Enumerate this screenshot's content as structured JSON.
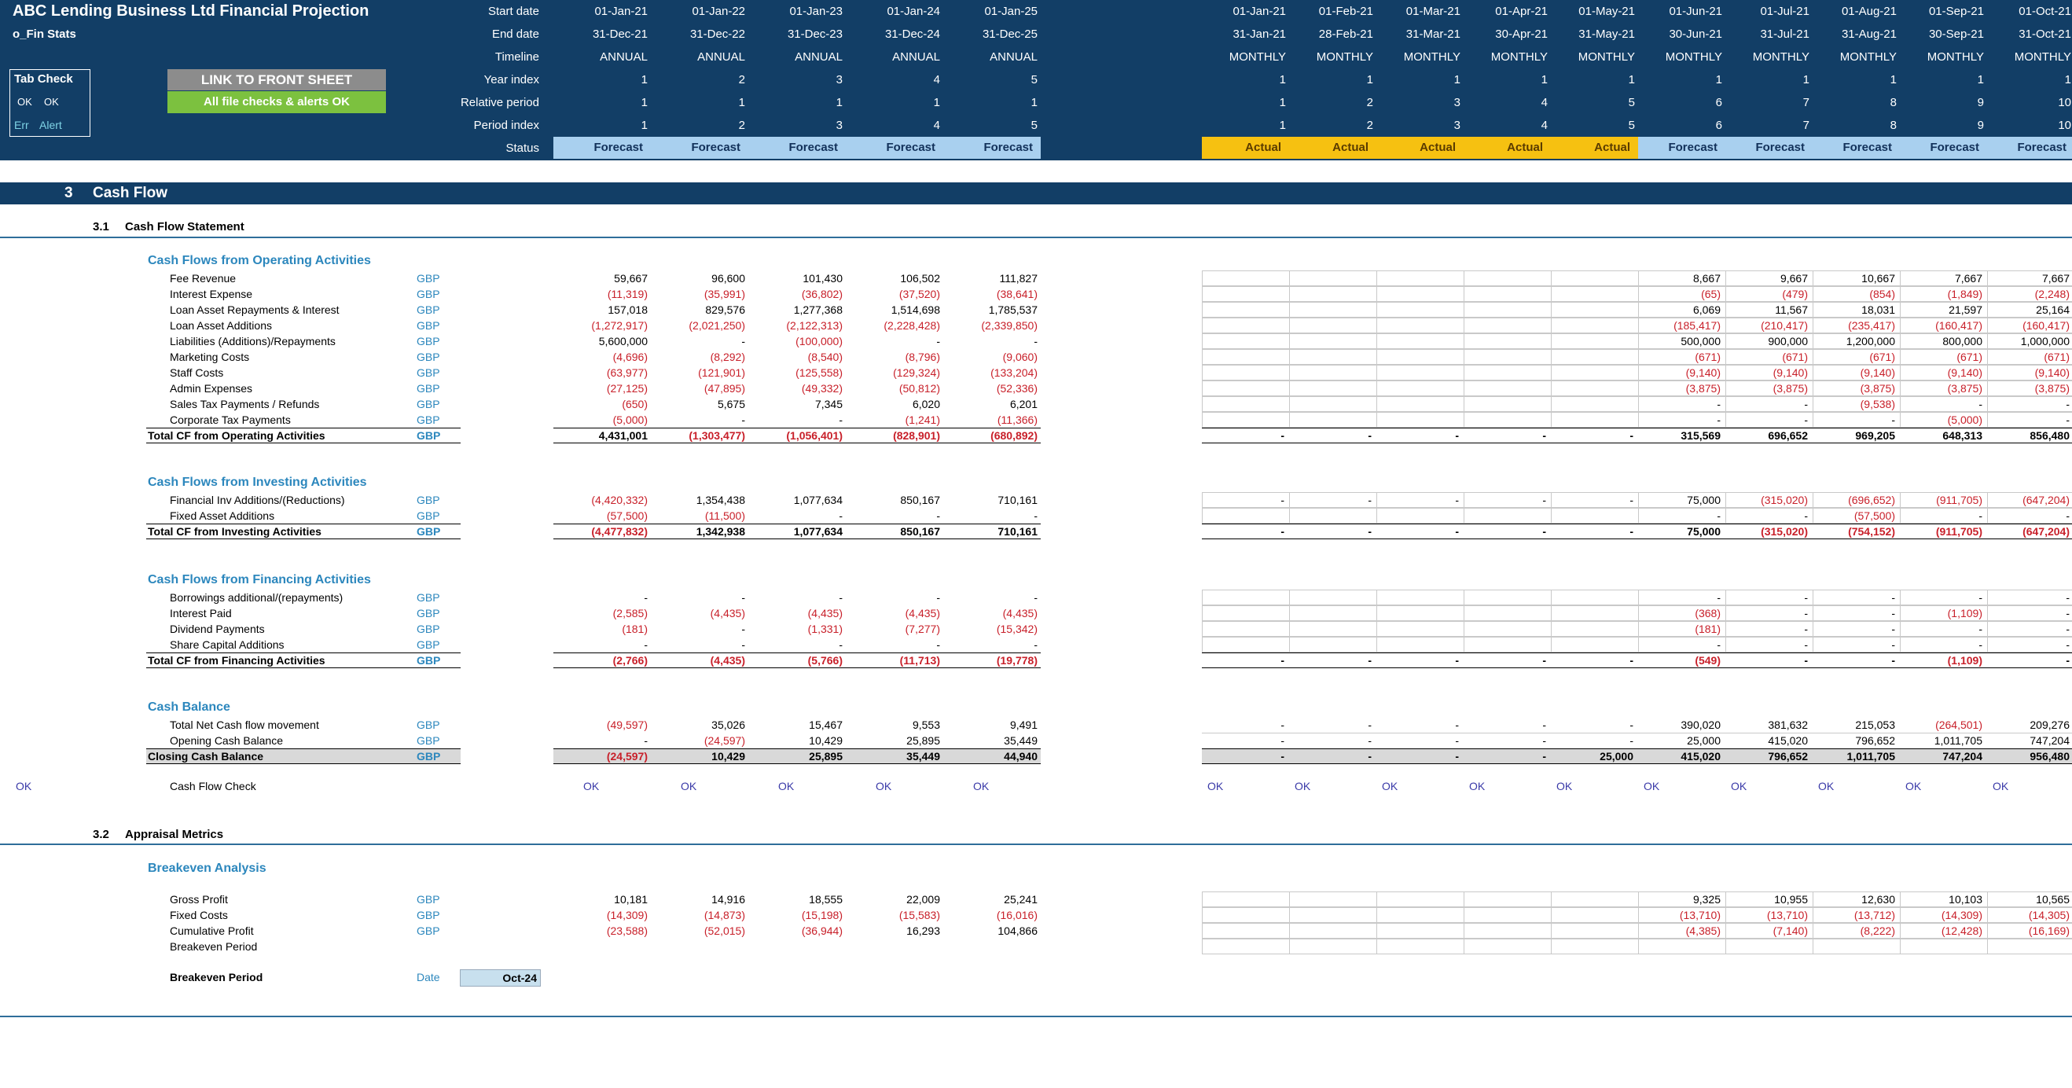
{
  "header": {
    "company": "ABC Lending Business Ltd Financial Projection",
    "sheet": "o_Fin Stats",
    "tab_check": {
      "title": "Tab Check",
      "ok1": "OK",
      "ok2": "OK",
      "err": "Err",
      "alert": "Alert"
    },
    "link_button": "LINK TO FRONT SHEET",
    "checks_status": "All file checks & alerts OK",
    "row_labels": [
      "Start date",
      "End date",
      "Timeline",
      "Year index",
      "Relative period",
      "Period index",
      "Status"
    ],
    "annual": [
      {
        "start": "01-Jan-21",
        "end": "31-Dec-21",
        "timeline": "ANNUAL",
        "year": "1",
        "rel": "1",
        "idx": "1",
        "status": "Forecast"
      },
      {
        "start": "01-Jan-22",
        "end": "31-Dec-22",
        "timeline": "ANNUAL",
        "year": "2",
        "rel": "1",
        "idx": "2",
        "status": "Forecast"
      },
      {
        "start": "01-Jan-23",
        "end": "31-Dec-23",
        "timeline": "ANNUAL",
        "year": "3",
        "rel": "1",
        "idx": "3",
        "status": "Forecast"
      },
      {
        "start": "01-Jan-24",
        "end": "31-Dec-24",
        "timeline": "ANNUAL",
        "year": "4",
        "rel": "1",
        "idx": "4",
        "status": "Forecast"
      },
      {
        "start": "01-Jan-25",
        "end": "31-Dec-25",
        "timeline": "ANNUAL",
        "year": "5",
        "rel": "1",
        "idx": "5",
        "status": "Forecast"
      }
    ],
    "monthly": [
      {
        "start": "01-Jan-21",
        "end": "31-Jan-21",
        "timeline": "MONTHLY",
        "year": "1",
        "rel": "1",
        "idx": "1",
        "status": "Actual"
      },
      {
        "start": "01-Feb-21",
        "end": "28-Feb-21",
        "timeline": "MONTHLY",
        "year": "1",
        "rel": "2",
        "idx": "2",
        "status": "Actual"
      },
      {
        "start": "01-Mar-21",
        "end": "31-Mar-21",
        "timeline": "MONTHLY",
        "year": "1",
        "rel": "3",
        "idx": "3",
        "status": "Actual"
      },
      {
        "start": "01-Apr-21",
        "end": "30-Apr-21",
        "timeline": "MONTHLY",
        "year": "1",
        "rel": "4",
        "idx": "4",
        "status": "Actual"
      },
      {
        "start": "01-May-21",
        "end": "31-May-21",
        "timeline": "MONTHLY",
        "year": "1",
        "rel": "5",
        "idx": "5",
        "status": "Actual"
      },
      {
        "start": "01-Jun-21",
        "end": "30-Jun-21",
        "timeline": "MONTHLY",
        "year": "1",
        "rel": "6",
        "idx": "6",
        "status": "Forecast"
      },
      {
        "start": "01-Jul-21",
        "end": "31-Jul-21",
        "timeline": "MONTHLY",
        "year": "1",
        "rel": "7",
        "idx": "7",
        "status": "Forecast"
      },
      {
        "start": "01-Aug-21",
        "end": "31-Aug-21",
        "timeline": "MONTHLY",
        "year": "1",
        "rel": "8",
        "idx": "8",
        "status": "Forecast"
      },
      {
        "start": "01-Sep-21",
        "end": "30-Sep-21",
        "timeline": "MONTHLY",
        "year": "1",
        "rel": "9",
        "idx": "9",
        "status": "Forecast"
      },
      {
        "start": "01-Oct-21",
        "end": "31-Oct-21",
        "timeline": "MONTHLY",
        "year": "1",
        "rel": "10",
        "idx": "10",
        "status": "Forecast"
      }
    ]
  },
  "section": {
    "num": "3",
    "title": "Cash Flow"
  },
  "sub31": {
    "num": "3.1",
    "title": "Cash Flow Statement"
  },
  "sub32": {
    "num": "3.2",
    "title": "Appraisal Metrics"
  },
  "blocks": {
    "operating": "Cash Flows from Operating Activities",
    "investing": "Cash Flows from Investing Activities",
    "financing": "Cash Flows from Financing Activities",
    "balance": "Cash Balance",
    "breakeven": "Breakeven Analysis"
  },
  "rows": {
    "fee": {
      "label": "Fee Revenue",
      "unit": "GBP",
      "annual": [
        "59,667",
        "96,600",
        "101,430",
        "106,502",
        "111,827"
      ],
      "monthly": [
        "",
        "",
        "",
        "",
        "",
        "8,667",
        "9,667",
        "10,667",
        "7,667",
        "7,667"
      ]
    },
    "interest": {
      "label": "Interest Expense",
      "unit": "GBP",
      "annual": [
        "(11,319)",
        "(35,991)",
        "(36,802)",
        "(37,520)",
        "(38,641)"
      ],
      "monthly": [
        "",
        "",
        "",
        "",
        "",
        "(65)",
        "(479)",
        "(854)",
        "(1,849)",
        "(2,248)"
      ]
    },
    "loanrep": {
      "label": "Loan Asset Repayments & Interest",
      "unit": "GBP",
      "annual": [
        "157,018",
        "829,576",
        "1,277,368",
        "1,514,698",
        "1,785,537"
      ],
      "monthly": [
        "",
        "",
        "",
        "",
        "",
        "6,069",
        "11,567",
        "18,031",
        "21,597",
        "25,164"
      ]
    },
    "loanadd": {
      "label": "Loan Asset Additions",
      "unit": "GBP",
      "annual": [
        "(1,272,917)",
        "(2,021,250)",
        "(2,122,313)",
        "(2,228,428)",
        "(2,339,850)"
      ],
      "monthly": [
        "",
        "",
        "",
        "",
        "",
        "(185,417)",
        "(210,417)",
        "(235,417)",
        "(160,417)",
        "(160,417)"
      ]
    },
    "liab": {
      "label": "Liabilities (Additions)/Repayments",
      "unit": "GBP",
      "annual": [
        "5,600,000",
        "-",
        "(100,000)",
        "-",
        "-"
      ],
      "monthly": [
        "",
        "",
        "",
        "",
        "",
        "500,000",
        "900,000",
        "1,200,000",
        "800,000",
        "1,000,000"
      ]
    },
    "mkt": {
      "label": "Marketing Costs",
      "unit": "GBP",
      "annual": [
        "(4,696)",
        "(8,292)",
        "(8,540)",
        "(8,796)",
        "(9,060)"
      ],
      "monthly": [
        "",
        "",
        "",
        "",
        "",
        "(671)",
        "(671)",
        "(671)",
        "(671)",
        "(671)"
      ]
    },
    "staff": {
      "label": "Staff Costs",
      "unit": "GBP",
      "annual": [
        "(63,977)",
        "(121,901)",
        "(125,558)",
        "(129,324)",
        "(133,204)"
      ],
      "monthly": [
        "",
        "",
        "",
        "",
        "",
        "(9,140)",
        "(9,140)",
        "(9,140)",
        "(9,140)",
        "(9,140)"
      ]
    },
    "admin": {
      "label": "Admin Expenses",
      "unit": "GBP",
      "annual": [
        "(27,125)",
        "(47,895)",
        "(49,332)",
        "(50,812)",
        "(52,336)"
      ],
      "monthly": [
        "",
        "",
        "",
        "",
        "",
        "(3,875)",
        "(3,875)",
        "(3,875)",
        "(3,875)",
        "(3,875)"
      ]
    },
    "salestax": {
      "label": "Sales Tax Payments / Refunds",
      "unit": "GBP",
      "annual": [
        "(650)",
        "5,675",
        "7,345",
        "6,020",
        "6,201"
      ],
      "monthly": [
        "",
        "",
        "",
        "",
        "",
        "-",
        "-",
        "(9,538)",
        "-",
        "-"
      ]
    },
    "corptax": {
      "label": "Corporate Tax Payments",
      "unit": "GBP",
      "annual": [
        "(5,000)",
        "-",
        "-",
        "(1,241)",
        "(11,366)"
      ],
      "monthly": [
        "",
        "",
        "",
        "",
        "",
        "-",
        "-",
        "-",
        "(5,000)",
        "-"
      ]
    },
    "totop": {
      "label": "Total CF from Operating Activities",
      "unit": "GBP",
      "annual": [
        "4,431,001",
        "(1,303,477)",
        "(1,056,401)",
        "(828,901)",
        "(680,892)"
      ],
      "monthly": [
        "-",
        "-",
        "-",
        "-",
        "-",
        "315,569",
        "696,652",
        "969,205",
        "648,313",
        "856,480"
      ]
    },
    "finv": {
      "label": "Financial Inv Additions/(Reductions)",
      "unit": "GBP",
      "annual": [
        "(4,420,332)",
        "1,354,438",
        "1,077,634",
        "850,167",
        "710,161"
      ],
      "monthly": [
        "-",
        "-",
        "-",
        "-",
        "-",
        "75,000",
        "(315,020)",
        "(696,652)",
        "(911,705)",
        "(647,204)"
      ]
    },
    "fixed": {
      "label": "Fixed Asset Additions",
      "unit": "GBP",
      "annual": [
        "(57,500)",
        "(11,500)",
        "-",
        "-",
        "-"
      ],
      "monthly": [
        "",
        "",
        "",
        "",
        "",
        "-",
        "-",
        "(57,500)",
        "-",
        "-"
      ]
    },
    "totinv": {
      "label": "Total CF from Investing Activities",
      "unit": "GBP",
      "annual": [
        "(4,477,832)",
        "1,342,938",
        "1,077,634",
        "850,167",
        "710,161"
      ],
      "monthly": [
        "-",
        "-",
        "-",
        "-",
        "-",
        "75,000",
        "(315,020)",
        "(754,152)",
        "(911,705)",
        "(647,204)"
      ]
    },
    "borrow": {
      "label": "Borrowings additional/(repayments)",
      "unit": "GBP",
      "annual": [
        "-",
        "-",
        "-",
        "-",
        "-"
      ],
      "monthly": [
        "",
        "",
        "",
        "",
        "",
        "-",
        "-",
        "-",
        "-",
        "-"
      ]
    },
    "intpaid": {
      "label": "Interest Paid",
      "unit": "GBP",
      "annual": [
        "(2,585)",
        "(4,435)",
        "(4,435)",
        "(4,435)",
        "(4,435)"
      ],
      "monthly": [
        "",
        "",
        "",
        "",
        "",
        "(368)",
        "-",
        "-",
        "(1,109)",
        "-"
      ]
    },
    "div": {
      "label": "Dividend Payments",
      "unit": "GBP",
      "annual": [
        "(181)",
        "-",
        "(1,331)",
        "(7,277)",
        "(15,342)"
      ],
      "monthly": [
        "",
        "",
        "",
        "",
        "",
        "(181)",
        "-",
        "-",
        "-",
        "-"
      ]
    },
    "share": {
      "label": "Share Capital Additions",
      "unit": "GBP",
      "annual": [
        "-",
        "-",
        "-",
        "-",
        "-"
      ],
      "monthly": [
        "",
        "",
        "",
        "",
        "",
        "-",
        "-",
        "-",
        "-",
        "-"
      ]
    },
    "totfin": {
      "label": "Total CF from Financing Activities",
      "unit": "GBP",
      "annual": [
        "(2,766)",
        "(4,435)",
        "(5,766)",
        "(11,713)",
        "(19,778)"
      ],
      "monthly": [
        "-",
        "-",
        "-",
        "-",
        "-",
        "(549)",
        "-",
        "-",
        "(1,109)",
        "-"
      ]
    },
    "netcf": {
      "label": "Total Net Cash flow movement",
      "unit": "GBP",
      "annual": [
        "(49,597)",
        "35,026",
        "15,467",
        "9,553",
        "9,491"
      ],
      "monthly": [
        "-",
        "-",
        "-",
        "-",
        "-",
        "390,020",
        "381,632",
        "215,053",
        "(264,501)",
        "209,276"
      ]
    },
    "open": {
      "label": "Opening Cash Balance",
      "unit": "GBP",
      "annual": [
        "-",
        "(24,597)",
        "10,429",
        "25,895",
        "35,449"
      ],
      "monthly": [
        "-",
        "-",
        "-",
        "-",
        "-",
        "25,000",
        "415,020",
        "796,652",
        "1,011,705",
        "747,204"
      ]
    },
    "close": {
      "label": "Closing Cash Balance",
      "unit": "GBP",
      "annual": [
        "(24,597)",
        "10,429",
        "25,895",
        "35,449",
        "44,940"
      ],
      "monthly": [
        "-",
        "-",
        "-",
        "-",
        "25,000",
        "415,020",
        "796,652",
        "1,011,705",
        "747,204",
        "956,480"
      ]
    },
    "gross": {
      "label": "Gross Profit",
      "unit": "GBP",
      "annual": [
        "10,181",
        "14,916",
        "18,555",
        "22,009",
        "25,241"
      ],
      "monthly": [
        "",
        "",
        "",
        "",
        "",
        "9,325",
        "10,955",
        "12,630",
        "10,103",
        "10,565"
      ]
    },
    "fixedc": {
      "label": "Fixed Costs",
      "unit": "GBP",
      "annual": [
        "(14,309)",
        "(14,873)",
        "(15,198)",
        "(15,583)",
        "(16,016)"
      ],
      "monthly": [
        "",
        "",
        "",
        "",
        "",
        "(13,710)",
        "(13,710)",
        "(13,712)",
        "(14,309)",
        "(14,305)"
      ]
    },
    "cumprof": {
      "label": "Cumulative Profit",
      "unit": "GBP",
      "annual": [
        "(23,588)",
        "(52,015)",
        "(36,944)",
        "16,293",
        "104,866"
      ],
      "monthly": [
        "",
        "",
        "",
        "",
        "",
        "(4,385)",
        "(7,140)",
        "(8,222)",
        "(12,428)",
        "(16,169)"
      ]
    },
    "bep": {
      "label": "Breakeven Period",
      "unit": "",
      "annual": [
        "",
        "",
        "",
        "",
        ""
      ],
      "monthly": [
        "",
        "",
        "",
        "",
        "",
        "",
        "",
        "",
        "",
        ""
      ]
    }
  },
  "check": {
    "left": "OK",
    "label": "Cash Flow Check",
    "annual": [
      "OK",
      "OK",
      "OK",
      "OK",
      "OK"
    ],
    "monthly": [
      "OK",
      "OK",
      "OK",
      "OK",
      "OK",
      "OK",
      "OK",
      "OK",
      "OK",
      "OK"
    ]
  },
  "breakeven": {
    "label": "Breakeven Period",
    "unit": "Date",
    "value": "Oct-24"
  },
  "colors": {
    "navy": "#123e66",
    "accent": "#2c87bd",
    "negative": "#c8202a",
    "forecast": "#a9d0ef",
    "actual": "#f6c111",
    "link_btn": "#8c8c8c",
    "ok_btn": "#7cc13f"
  }
}
